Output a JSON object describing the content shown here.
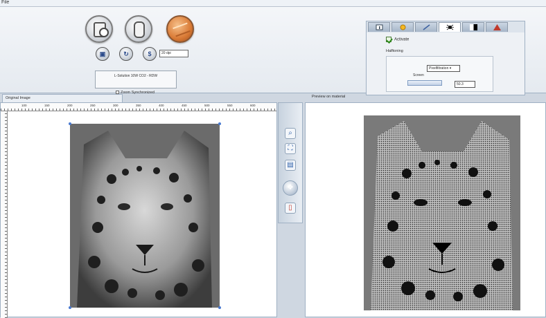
{
  "menubar": {
    "label": "File"
  },
  "toolbar": {
    "dpi_value": "20 dpi",
    "device_text": "L-Solution 10W CO2 - RDW",
    "zoom_sync_label": "Zoom Synchronized"
  },
  "settings_panel": {
    "activate_label": "Activate",
    "halftone_label": "Halftoning",
    "method_value": "Pixelfiltration ▾",
    "screen_label": "Screen",
    "screen_value": "50.3"
  },
  "original": {
    "tab_label": "Original Image",
    "ruler_labels": [
      "100",
      "150",
      "200",
      "250",
      "300",
      "350",
      "400",
      "450",
      "500",
      "550",
      "600"
    ]
  },
  "preview": {
    "label": "Preview on material"
  },
  "colors": {
    "accent": "#2a5da8",
    "wood": "#d97a35",
    "activate_check": "#2e8a1c"
  }
}
